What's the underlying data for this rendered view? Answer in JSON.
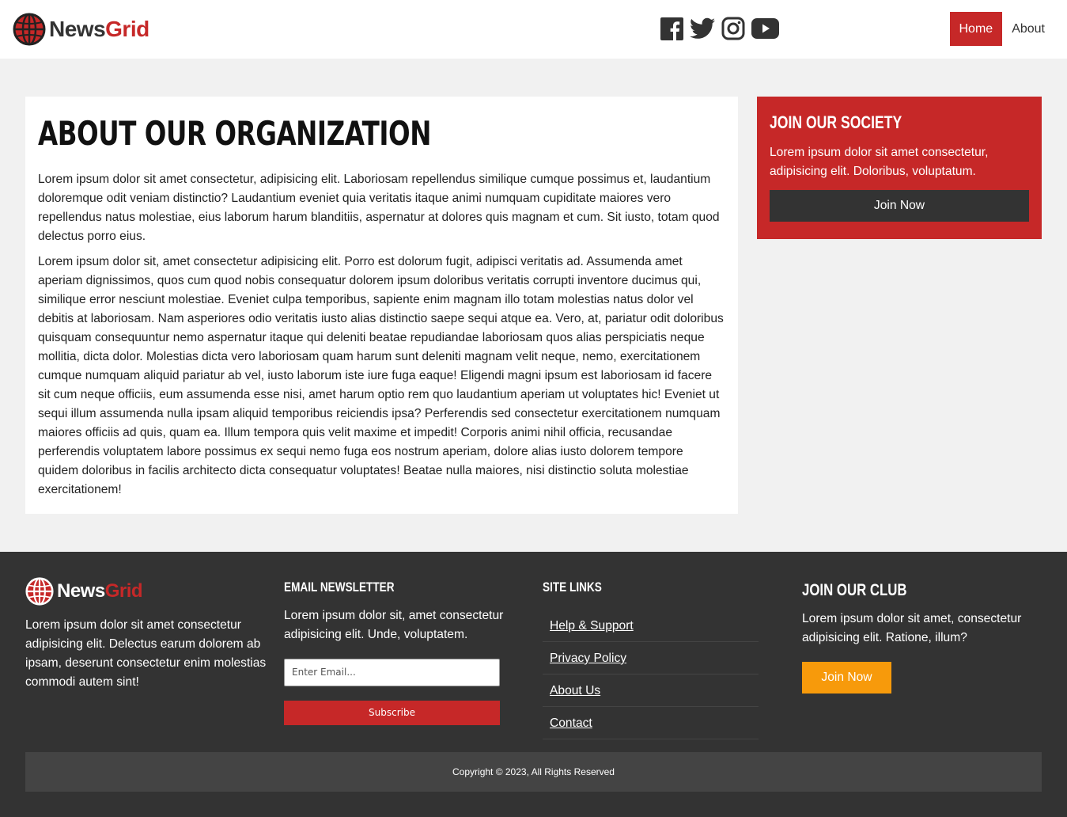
{
  "brand": {
    "part1": "News",
    "part2": "Grid",
    "accent": "#c62828",
    "dark": "#333333",
    "orange": "#f79a0b"
  },
  "header": {
    "social": [
      "facebook-icon",
      "twitter-icon",
      "instagram-icon",
      "youtube-icon"
    ],
    "nav": [
      {
        "label": "Home",
        "active": true
      },
      {
        "label": "About",
        "active": false
      }
    ]
  },
  "main": {
    "title": "About Our Organization",
    "paragraphs": [
      "Lorem ipsum dolor sit amet consectetur, adipisicing elit. Laboriosam repellendus similique cumque possimus et, laudantium doloremque odit veniam distinctio? Laudantium eveniet quia veritatis itaque animi numquam cupiditate maiores vero repellendus natus molestiae, eius laborum harum blanditiis, aspernatur at dolores quis magnam et cum. Sit iusto, totam quod delectus porro eius.",
      "Lorem ipsum dolor sit, amet consectetur adipisicing elit. Porro est dolorum fugit, adipisci veritatis ad. Assumenda amet aperiam dignissimos, quos cum quod nobis consequatur dolorem ipsum doloribus veritatis corrupti inventore ducimus qui, similique error nesciunt molestiae. Eveniet culpa temporibus, sapiente enim magnam illo totam molestias natus dolor vel debitis at laboriosam. Nam asperiores odio veritatis iusto alias distinctio saepe sequi atque ea. Vero, at, pariatur odit doloribus quisquam consequuntur nemo aspernatur itaque qui deleniti beatae repudiandae laboriosam quos alias perspiciatis neque mollitia, dicta dolor. Molestias dicta vero laboriosam quam harum sunt deleniti magnam velit neque, nemo, exercitationem cumque numquam aliquid pariatur ab vel, iusto laborum iste iure fuga eaque! Eligendi magni ipsum est laboriosam id facere sit cum neque officiis, eum assumenda esse nisi, amet harum optio rem quo laudantium aperiam ut voluptates hic! Eveniet ut sequi illum assumenda nulla ipsam aliquid temporibus reiciendis ipsa? Perferendis sed consectetur exercitationem numquam maiores officiis ad quis, quam ea. Illum tempora quis velit maxime et impedit! Corporis animi nihil officia, recusandae perferendis voluptatem labore possimus ex sequi nemo fuga eos nostrum aperiam, dolore alias iusto dolorem tempore quidem doloribus in facilis architecto dicta consequatur voluptates! Beatae nulla maiores, nisi distinctio soluta molestiae exercitationem!"
    ]
  },
  "sidebar": {
    "title": "Join Our Society",
    "text": "Lorem ipsum dolor sit amet consectetur, adipisicing elit. Doloribus, voluptatum.",
    "button": "Join Now"
  },
  "footer": {
    "about": "Lorem ipsum dolor sit amet consectetur adipisicing elit. Delectus earum dolorem ab ipsam, deserunt consectetur enim molestias commodi autem sint!",
    "newsletter": {
      "title": "Email Newsletter",
      "text": "Lorem ipsum dolor sit, amet consectetur adipisicing elit. Unde, voluptatem.",
      "placeholder": "Enter Email...",
      "button": "Subscribe"
    },
    "links": {
      "title": "Site Links",
      "items": [
        "Help & Support",
        "Privacy Policy",
        "About Us",
        "Contact"
      ]
    },
    "club": {
      "title": "Join Our Club",
      "text": "Lorem ipsum dolor sit amet, consectetur adipisicing elit. Ratione, illum?",
      "button": "Join Now"
    },
    "copyright": "Copyright © 2023, All Rights Reserved"
  }
}
